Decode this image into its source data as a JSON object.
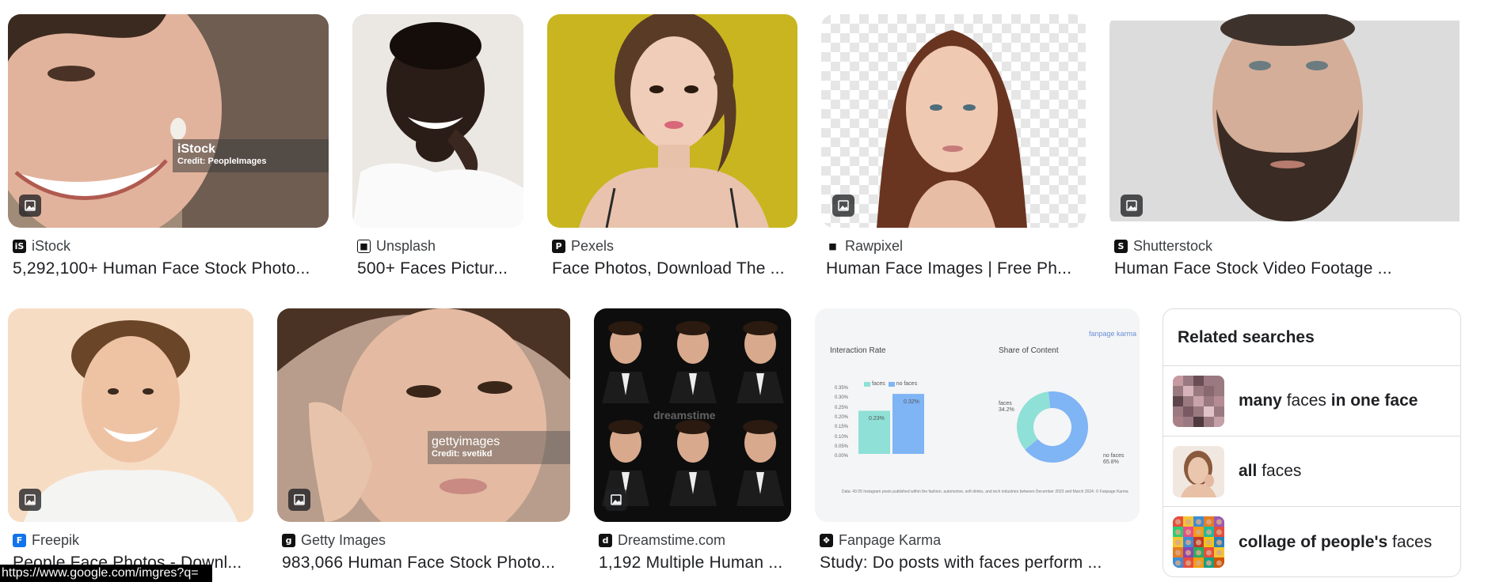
{
  "results_row1": [
    {
      "source": "iStock",
      "title": "5,292,100+ Human Face Stock Photo...",
      "favicon": "iS",
      "favicon_color": "#111111",
      "watermark": "iStock",
      "credit": "Credit: PeopleImages"
    },
    {
      "source": "Unsplash",
      "title": "500+ Faces Pictur...",
      "favicon": "■",
      "favicon_color": "#111111"
    },
    {
      "source": "Pexels",
      "title": "Face Photos, Download The ...",
      "favicon": "P",
      "favicon_color": "#111111"
    },
    {
      "source": "Rawpixel",
      "title": "Human Face Images | Free Ph...",
      "favicon": "■",
      "favicon_color": "#111111"
    },
    {
      "source": "Shutterstock",
      "title": "Human Face Stock Video Footage ...",
      "favicon": "S",
      "favicon_color": "#111111"
    }
  ],
  "results_row2": [
    {
      "source": "Freepik",
      "title": "People Face Photos - Downl...",
      "favicon": "F",
      "favicon_color": "#1273eb"
    },
    {
      "source": "Getty Images",
      "title": "983,066 Human Face Stock Photo...",
      "favicon": "g",
      "favicon_color": "#111111",
      "watermark": "gettyimages",
      "credit": "Credit: svetikd"
    },
    {
      "source": "Dreamstime.com",
      "title": "1,192 Multiple Human ...",
      "favicon": "d",
      "favicon_color": "#111111",
      "watermark": "dreamstime"
    },
    {
      "source": "Fanpage Karma",
      "title": "Study: Do posts with faces perform ...",
      "favicon": "❖",
      "favicon_color": "#111111"
    }
  ],
  "fanpage_chart": {
    "brand": "fanpage karma",
    "left_title": "Interaction Rate",
    "right_title": "Share of Content",
    "legend_faces": "faces",
    "legend_no_faces": "no faces",
    "y_ticks": [
      "0.35%",
      "0.30%",
      "0.25%",
      "0.20%",
      "0.15%",
      "0.10%",
      "0.05%",
      "0.00%"
    ],
    "bar_faces_label": "0.23%",
    "bar_no_faces_label": "0.32%",
    "bar_values": [
      0.23,
      0.32
    ],
    "pie_faces_label": "faces",
    "pie_faces_pct": "34.2%",
    "pie_no_faces_label": "no faces",
    "pie_no_faces_pct": "65.8%",
    "pie_fraction_faces": 0.342,
    "footnote": "Data: 43 05 Instagram posts published within the fashion, automotive, soft drinks, and tech industries between December 2023 and March 2024. © Fanpage Karma"
  },
  "related": {
    "heading": "Related searches",
    "items": [
      {
        "bold1": "many",
        "normal": " faces ",
        "bold2": "in one face"
      },
      {
        "bold1": "all",
        "normal": " faces",
        "bold2": ""
      },
      {
        "bold1": "collage of people's",
        "normal": " faces",
        "bold2": ""
      }
    ]
  },
  "status_url": "https://www.google.com/imgres?q=",
  "colors": {
    "accent_teal": "#8fe0d6",
    "accent_blue": "#7fb4f5"
  }
}
